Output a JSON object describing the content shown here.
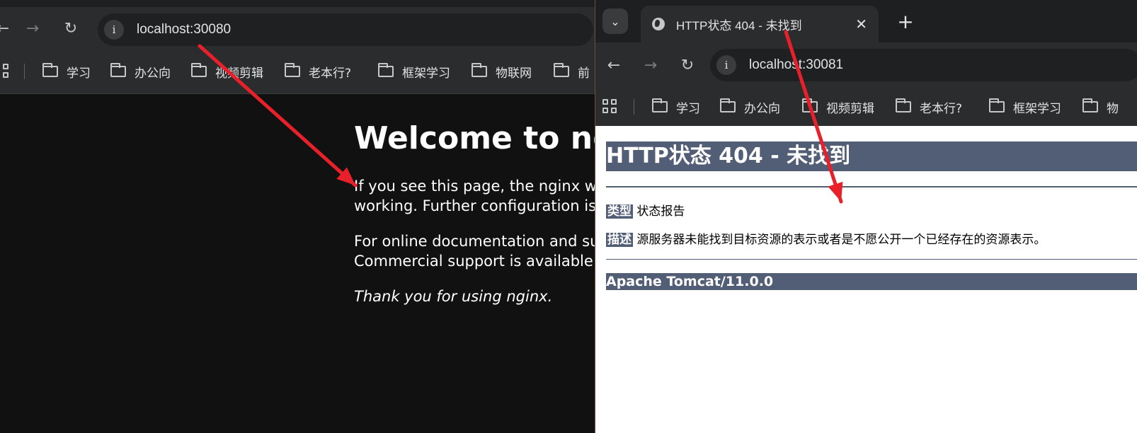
{
  "left_window": {
    "url": "localhost:30080",
    "bookmarks": [
      "学习",
      "办公向",
      "视频剪辑",
      "老本行?",
      "框架学习",
      "物联网",
      "前"
    ],
    "page": {
      "heading": "Welcome to nginx!",
      "para1_line1": "If you see this page, the nginx web server is successfully installed and",
      "para1_line2": "working. Further configuration is required.",
      "para2_line1": "For online documentation and support please refer to nginx.org.",
      "para2_line2": "Commercial support is available at nginx.com.",
      "thanks": "Thank you for using nginx."
    }
  },
  "right_window": {
    "tab_title": "HTTP状态 404 - 未找到",
    "url": "localhost:30081",
    "bookmarks": [
      "学习",
      "办公向",
      "视频剪辑",
      "老本行?",
      "框架学习",
      "物"
    ],
    "page": {
      "heading": "HTTP状态 404 - 未找到",
      "type_label": "类型",
      "type_value": "状态报告",
      "desc_label": "描述",
      "desc_value": "源服务器未能找到目标资源的表示或者是不愿公开一个已经存在的资源表示。",
      "footer": "Apache Tomcat/11.0.0"
    }
  },
  "colors": {
    "annotation_arrow": "#e8202a",
    "tomcat_header": "#525d76",
    "dark_toolbar": "#2b2c2e"
  }
}
